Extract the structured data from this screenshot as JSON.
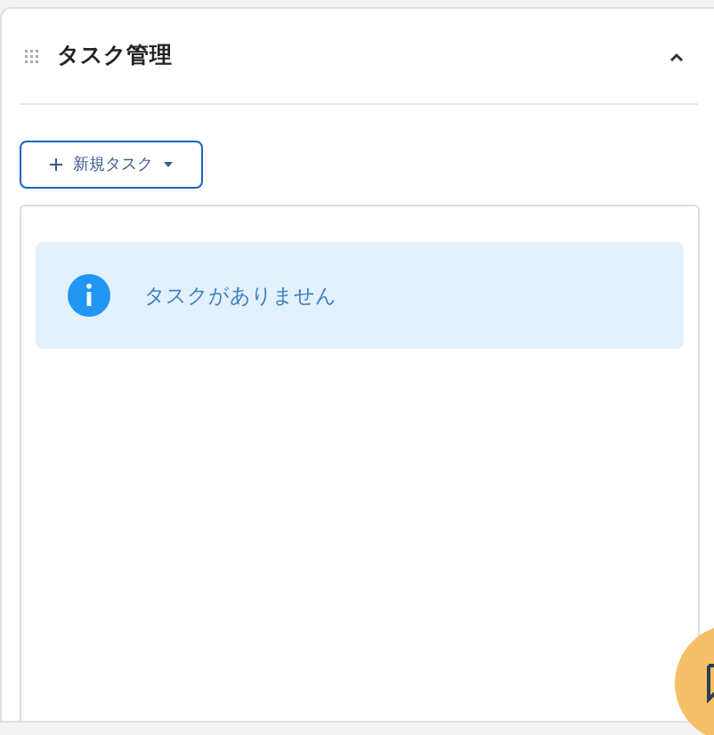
{
  "panel": {
    "title": "タスク管理",
    "expanded": true
  },
  "new_task_button": {
    "label": "新規タスク"
  },
  "alert": {
    "message": "タスクがありません"
  }
}
